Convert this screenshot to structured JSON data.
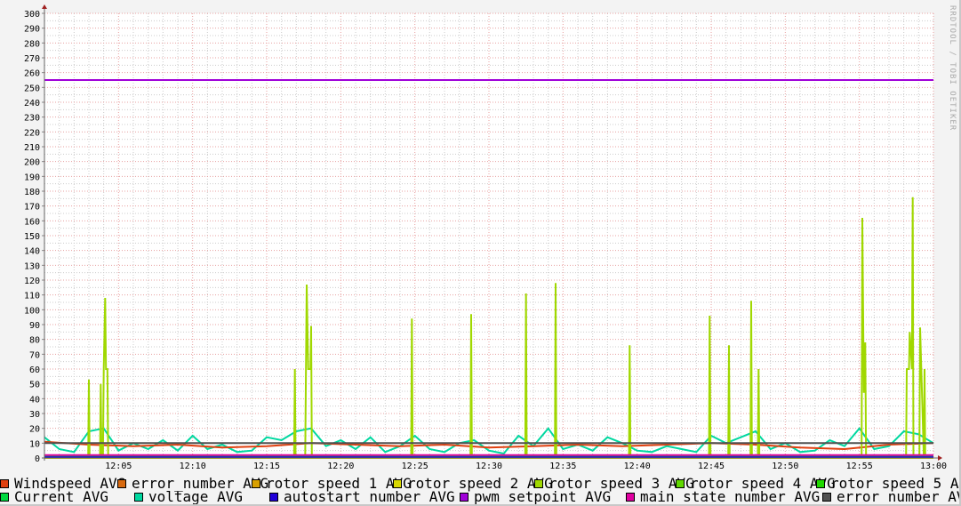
{
  "watermark": "RRDTOOL / TOBI OETIKER",
  "chart_data": {
    "type": "line",
    "title": "",
    "xlabel": "",
    "ylabel": "",
    "ylim": [
      0,
      300
    ],
    "xlim_minutes_from_1200": [
      0,
      60
    ],
    "grid": true,
    "yticks": [
      0,
      10,
      20,
      30,
      40,
      50,
      60,
      70,
      80,
      90,
      100,
      110,
      120,
      130,
      140,
      150,
      160,
      170,
      180,
      190,
      200,
      210,
      220,
      230,
      240,
      250,
      260,
      270,
      280,
      290,
      300
    ],
    "xticks": [
      {
        "t": 5,
        "label": "12:05"
      },
      {
        "t": 10,
        "label": "12:10"
      },
      {
        "t": 15,
        "label": "12:15"
      },
      {
        "t": 20,
        "label": "12:20"
      },
      {
        "t": 25,
        "label": "12:25"
      },
      {
        "t": 30,
        "label": "12:30"
      },
      {
        "t": 35,
        "label": "12:35"
      },
      {
        "t": 40,
        "label": "12:40"
      },
      {
        "t": 45,
        "label": "12:45"
      },
      {
        "t": 50,
        "label": "12:50"
      },
      {
        "t": 55,
        "label": "12:55"
      },
      {
        "t": 60,
        "label": "13:00"
      }
    ],
    "legend_placement": "bottom",
    "series": [
      {
        "name": "Windspeed AVG",
        "color": "#e04010",
        "x": [
          0,
          3,
          6,
          9,
          12,
          15,
          18,
          21,
          24,
          27,
          30,
          33,
          36,
          39,
          42,
          45,
          48,
          51,
          54,
          57,
          60
        ],
        "y": [
          11,
          9,
          8,
          9,
          7,
          8,
          10,
          9,
          8,
          9,
          7,
          8,
          9,
          8,
          9,
          10,
          9,
          7,
          6,
          9,
          10
        ]
      },
      {
        "name": "error_number AVG",
        "color": "#d86a10",
        "x": [
          0,
          60
        ],
        "y": [
          0,
          0
        ]
      },
      {
        "name": "rotor speed 1 AVG",
        "color": "#d8a000",
        "x": [
          0,
          60
        ],
        "y": [
          0,
          0
        ]
      },
      {
        "name": "rotor speed 2 AVG",
        "color": "#d8d800",
        "x": [
          0,
          60
        ],
        "y": [
          0,
          0
        ]
      },
      {
        "name": "rotor speed 3 AVG",
        "color": "#a0d800",
        "x": [
          0,
          2.95,
          3.0,
          3.05,
          3.75,
          3.8,
          3.85,
          3.95,
          4.0,
          4.1,
          4.15,
          4.25,
          4.3,
          16.85,
          16.9,
          16.95,
          17.6,
          17.7,
          17.8,
          17.95,
          18.0,
          18.05,
          24.75,
          24.8,
          24.85,
          28.75,
          28.8,
          28.85,
          32.45,
          32.5,
          32.55,
          34.45,
          34.5,
          34.55,
          39.45,
          39.5,
          39.55,
          44.85,
          44.9,
          44.95,
          46.15,
          46.2,
          46.25,
          47.65,
          47.7,
          47.75,
          48.15,
          48.2,
          48.25,
          55.15,
          55.2,
          55.3,
          55.4,
          55.45,
          58.15,
          58.2,
          58.35,
          58.4,
          58.55,
          58.6,
          58.65,
          59.05,
          59.1,
          59.35,
          59.4,
          59.45,
          60
        ],
        "y": [
          0,
          0,
          53,
          0,
          0,
          50,
          0,
          0,
          60,
          108,
          60,
          60,
          0,
          0,
          60,
          0,
          0,
          117,
          60,
          60,
          89,
          0,
          0,
          94,
          0,
          0,
          97,
          0,
          0,
          111,
          0,
          0,
          118,
          0,
          0,
          76,
          0,
          0,
          96,
          0,
          0,
          76,
          0,
          0,
          106,
          0,
          0,
          60,
          0,
          0,
          162,
          44,
          78,
          0,
          0,
          60,
          60,
          85,
          60,
          176,
          0,
          0,
          88,
          0,
          60,
          0,
          0
        ]
      },
      {
        "name": "rotor speed 4 AVG",
        "color": "#60d800",
        "x": [
          0,
          60
        ],
        "y": [
          0,
          0
        ]
      },
      {
        "name": "rotor speed 5 AVG",
        "color": "#20d800",
        "x": [
          0,
          60
        ],
        "y": [
          0,
          0
        ]
      },
      {
        "name": "Current AVG",
        "color": "#00d840",
        "x": [
          0,
          60
        ],
        "y": [
          1,
          1
        ]
      },
      {
        "name": "voltage AVG",
        "color": "#00d8a0",
        "x": [
          0,
          1,
          2,
          3,
          4,
          5,
          6,
          7,
          8,
          9,
          10,
          11,
          12,
          13,
          14,
          15,
          16,
          17,
          18,
          19,
          20,
          21,
          22,
          23,
          24,
          25,
          26,
          27,
          28,
          29,
          30,
          31,
          32,
          33,
          34,
          35,
          36,
          37,
          38,
          39,
          40,
          41,
          42,
          43,
          44,
          45,
          46,
          47,
          48,
          49,
          50,
          51,
          52,
          53,
          54,
          55,
          56,
          57,
          58,
          59,
          60
        ],
        "y": [
          14,
          6,
          4,
          18,
          20,
          5,
          10,
          6,
          12,
          5,
          15,
          6,
          9,
          4,
          5,
          14,
          12,
          18,
          20,
          8,
          12,
          6,
          14,
          4,
          8,
          15,
          6,
          4,
          10,
          12,
          5,
          3,
          15,
          8,
          20,
          6,
          9,
          5,
          14,
          10,
          5,
          4,
          8,
          6,
          4,
          15,
          10,
          14,
          18,
          6,
          10,
          4,
          5,
          12,
          8,
          20,
          6,
          8,
          18,
          16,
          10
        ]
      },
      {
        "name": "autostart_number AVG",
        "color": "#2000d8",
        "x": [
          0,
          60
        ],
        "y": [
          0.5,
          0.5
        ]
      },
      {
        "name": "pwm_setpoint AVG",
        "color": "#a000d8",
        "x": [
          0,
          60
        ],
        "y": [
          255,
          255
        ]
      },
      {
        "name": "main_state_number AVG",
        "color": "#e000a0",
        "x": [
          0,
          60
        ],
        "y": [
          2,
          2
        ]
      },
      {
        "name": "error_number AVG",
        "color": "#505050",
        "x": [
          0,
          60
        ],
        "y": [
          10,
          10
        ]
      }
    ]
  }
}
